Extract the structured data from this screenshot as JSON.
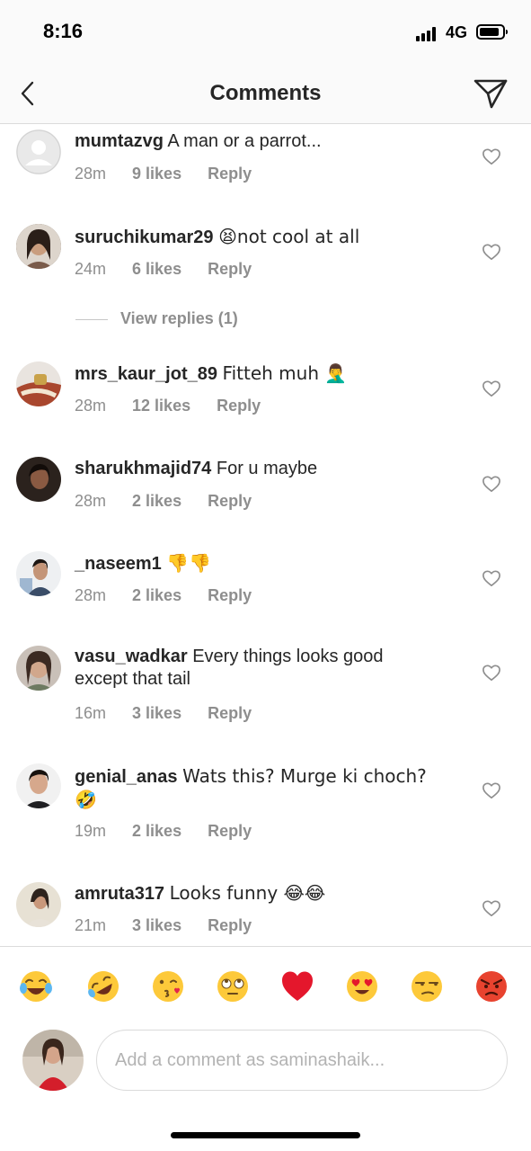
{
  "status_bar": {
    "time": "8:16",
    "network": "4G"
  },
  "header": {
    "title": "Comments"
  },
  "comments": [
    {
      "username": "mumtazvg",
      "text": "A man or a parrot...",
      "time": "28m",
      "likes": "9 likes",
      "reply": "Reply"
    },
    {
      "username": "suruchikumar29",
      "text": "😫not cool at all",
      "time": "24m",
      "likes": "6 likes",
      "reply": "Reply"
    },
    {
      "username": "mrs_kaur_jot_89",
      "text": "Fitteh muh 🤦‍♂️",
      "time": "28m",
      "likes": "12 likes",
      "reply": "Reply"
    },
    {
      "username": "sharukhmajid74",
      "text": "For u maybe",
      "time": "28m",
      "likes": "2 likes",
      "reply": "Reply"
    },
    {
      "username": "_naseem1",
      "text": "👎👎",
      "time": "28m",
      "likes": "2 likes",
      "reply": "Reply"
    },
    {
      "username": "vasu_wadkar",
      "text": "Every things looks good except that tail",
      "time": "16m",
      "likes": "3 likes",
      "reply": "Reply"
    },
    {
      "username": "genial_anas",
      "text": "Wats this? Murge ki choch? 🤣",
      "time": "19m",
      "likes": "2 likes",
      "reply": "Reply"
    },
    {
      "username": "amruta317",
      "text": "Looks funny 😂😂",
      "time": "21m",
      "likes": "3 likes",
      "reply": "Reply"
    }
  ],
  "view_replies": "View replies (1)",
  "emoji_bar": [
    "😂",
    "🤣",
    "😘",
    "🙄",
    "❤️",
    "😍",
    "😒",
    "😡"
  ],
  "composer": {
    "placeholder": "Add a comment as saminashaik..."
  },
  "colors": {
    "text": "#262626",
    "secondary": "#8e8e8e",
    "border": "#dbdbdb",
    "heart_red": "#ed4956"
  },
  "icons": [
    "back-chevron-icon",
    "paper-plane-icon",
    "heart-outline-icon"
  ]
}
